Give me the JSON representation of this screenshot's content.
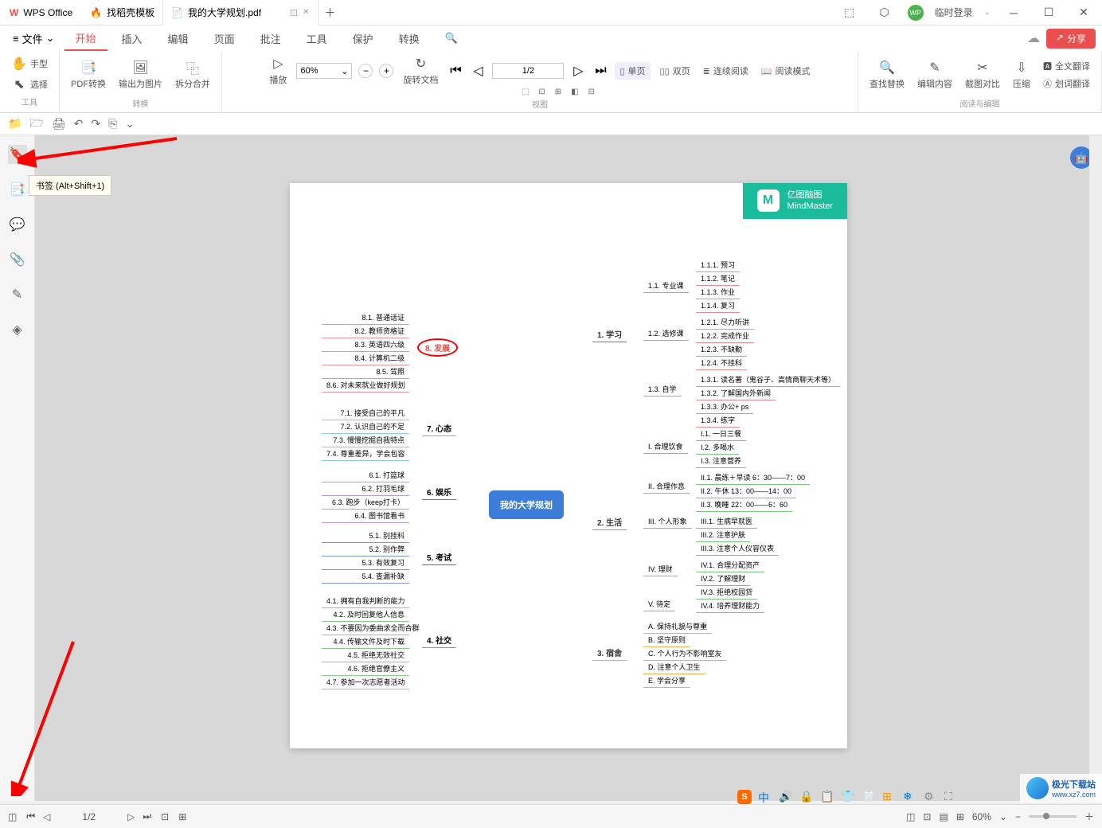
{
  "app": {
    "name": "WPS Office"
  },
  "tabs": [
    {
      "icon": "🔥",
      "label": "找稻壳模板"
    },
    {
      "icon": "📄",
      "label": "我的大学规划.pdf"
    }
  ],
  "tab_add": "＋",
  "login": "临时登录",
  "window_icons": {
    "box": "⬚",
    "cube": "⬡",
    "min": "─",
    "max": "☐",
    "close": "✕"
  },
  "file_menu": {
    "icon": "≡",
    "label": "文件",
    "caret": "⌄"
  },
  "menu": [
    "开始",
    "插入",
    "编辑",
    "页面",
    "批注",
    "工具",
    "保护",
    "转换"
  ],
  "search_icon": "🔍",
  "cloud_icon": "☁",
  "share": "分享",
  "ribbon": {
    "tools": {
      "hand": "手型",
      "select": "选择",
      "label": "工具",
      "hand_icon": "✋",
      "select_icon": "⬉"
    },
    "convert": {
      "pdf": "PDF转换",
      "image": "输出为图片",
      "split": "拆分合并",
      "label": "转换",
      "pdf_icon": "📑",
      "image_icon": "🖼",
      "split_icon": "⿻"
    },
    "play": {
      "label": "播放",
      "icon": "▷"
    },
    "zoom": {
      "value": "60%",
      "out": "−",
      "in": "+"
    },
    "rotate": {
      "label": "旋转文档",
      "icon": "↻"
    },
    "view_icons": [
      "⬚",
      "⊡",
      "⊞",
      "◧",
      "⊟"
    ],
    "page_mode": {
      "single": "单页",
      "double": "双页",
      "continuous": "连续阅读",
      "read": "阅读模式",
      "single_icon": "▯",
      "double_icon": "▯▯",
      "cont_icon": "≣",
      "read_icon": "📖",
      "label": "视图"
    },
    "nav": {
      "first": "⏮",
      "prev": "◁",
      "page": "1/2",
      "next": "▷",
      "last": "⏭"
    },
    "edit": {
      "find": "查找替换",
      "content": "编辑内容",
      "crop": "截图对比",
      "compress": "压缩",
      "translate": "全文翻译",
      "word_translate": "划词翻译",
      "find_icon": "🔍",
      "content_icon": "✎",
      "crop_icon": "✂",
      "compress_icon": "⇩",
      "translate_icon": "🅰",
      "word_icon": "Ⓐ",
      "label": "阅读与编辑"
    }
  },
  "quickbar": [
    "📁",
    "🗁",
    "🖨",
    "↶",
    "↷",
    "⎘",
    "⌄"
  ],
  "sidebar": {
    "bookmark": "🔖",
    "outline": "📑",
    "comment": "💬",
    "attach": "📎",
    "sign": "✎",
    "layers": "◈",
    "tooltip": "书签 (Alt+Shift+1)"
  },
  "float_icon": "🤖",
  "mindmap": {
    "brand": {
      "name": "亿图脑图",
      "sub": "MindMaster",
      "logo": "M"
    },
    "center": "我的大学规划",
    "right": [
      {
        "label": "1. 学习",
        "children": [
          {
            "label": "1.1. 专业课",
            "leaves": [
              "1.1.1. 预习",
              "1.1.2. 笔记",
              "1.1.3. 作业",
              "1.1.4. 复习"
            ]
          },
          {
            "label": "1.2. 选修课",
            "leaves": [
              "1.2.1. 尽力听讲",
              "1.2.2. 完成作业",
              "1.2.3. 不缺勤",
              "1.2.4. 不挂科"
            ]
          },
          {
            "label": "1.3. 自学",
            "leaves": [
              "1.3.1. 读名著（鬼谷子、高情商聊天术等）",
              "1.3.2. 了解国内外新闻",
              "1.3.3. 办公+ ps",
              "1.3.4. 练字"
            ]
          }
        ]
      },
      {
        "label": "2. 生活",
        "children": [
          {
            "label": "I. 合理饮食",
            "leaves": [
              "I.1. 一日三餐",
              "I.2. 多喝水",
              "I.3. 注意营养"
            ]
          },
          {
            "label": "II. 合理作息",
            "leaves": [
              "II.1. 晨练＋早读 6：30——7：00",
              "II.2. 午休 13：00——14：00",
              "II.3. 晚睡 22：00——6：60"
            ]
          },
          {
            "label": "III. 个人形象",
            "leaves": [
              "III.1. 生病早就医",
              "III.2. 注意护肤",
              "III.3. 注意个人仪容仪表"
            ]
          },
          {
            "label": "IV. 理财",
            "leaves": [
              "IV.1. 合理分配资产",
              "IV.2. 了解理财",
              "IV.3. 拒绝校园贷",
              "IV.4. 培养理财能力"
            ]
          },
          {
            "label": "V. 待定",
            "leaves": []
          }
        ]
      },
      {
        "label": "3. 宿舍",
        "children": [],
        "leaves": [
          "A. 保持礼貌与尊重",
          "B. 坚守原则",
          "C. 个人行为不影响室友",
          "D. 注意个人卫生",
          "E. 学会分享"
        ]
      }
    ],
    "left": [
      {
        "label": "8. 发展",
        "highlight": true,
        "leaves": [
          "8.1. 普通话证",
          "8.2. 教师资格证",
          "8.3. 英语四六级",
          "8.4. 计算机二级",
          "8.5. 驾照",
          "8.6. 对未来就业做好规划"
        ]
      },
      {
        "label": "7. 心态",
        "leaves": [
          "7.1. 接受自己的平凡",
          "7.2. 认识自己的不足",
          "7.3. 慢慢挖掘自我特点",
          "7.4. 尊重差异，学会包容"
        ]
      },
      {
        "label": "6. 娱乐",
        "leaves": [
          "6.1. 打篮球",
          "6.2. 打羽毛球",
          "6.3. 跑步（keep打卡）",
          "6.4. 图书馆看书"
        ]
      },
      {
        "label": "5. 考试",
        "leaves": [
          "5.1. 别挂科",
          "5.2. 别作弊",
          "5.3. 有效复习",
          "5.4. 查漏补缺"
        ]
      },
      {
        "label": "4. 社交",
        "leaves": [
          "4.1. 拥有自我判断的能力",
          "4.2. 及时回复他人信息",
          "4.3. 不要因为委曲求全而合群",
          "4.4. 传输文件及时下载",
          "4.5. 拒绝无效社交",
          "4.6. 拒绝官僚主义",
          "4.7. 参加一次志愿者活动"
        ]
      }
    ]
  },
  "statusbar": {
    "panel": "◫",
    "first": "⏮",
    "prev": "◁",
    "page": "1/2",
    "next": "▷",
    "last": "⏭",
    "fit1": "⊡",
    "fit2": "⊞",
    "tray": [
      "S",
      "中",
      "🔊",
      "🔒",
      "📋",
      "👕",
      "🦷",
      "⊞",
      "❄",
      "⚙",
      "⛶"
    ],
    "icons": [
      "◫",
      "⊡",
      "▤",
      "⊞"
    ],
    "zoom": "60%",
    "minus": "−",
    "plus": "＋"
  },
  "watermark": {
    "text": "极光下载站",
    "url": "www.xz7.com"
  }
}
